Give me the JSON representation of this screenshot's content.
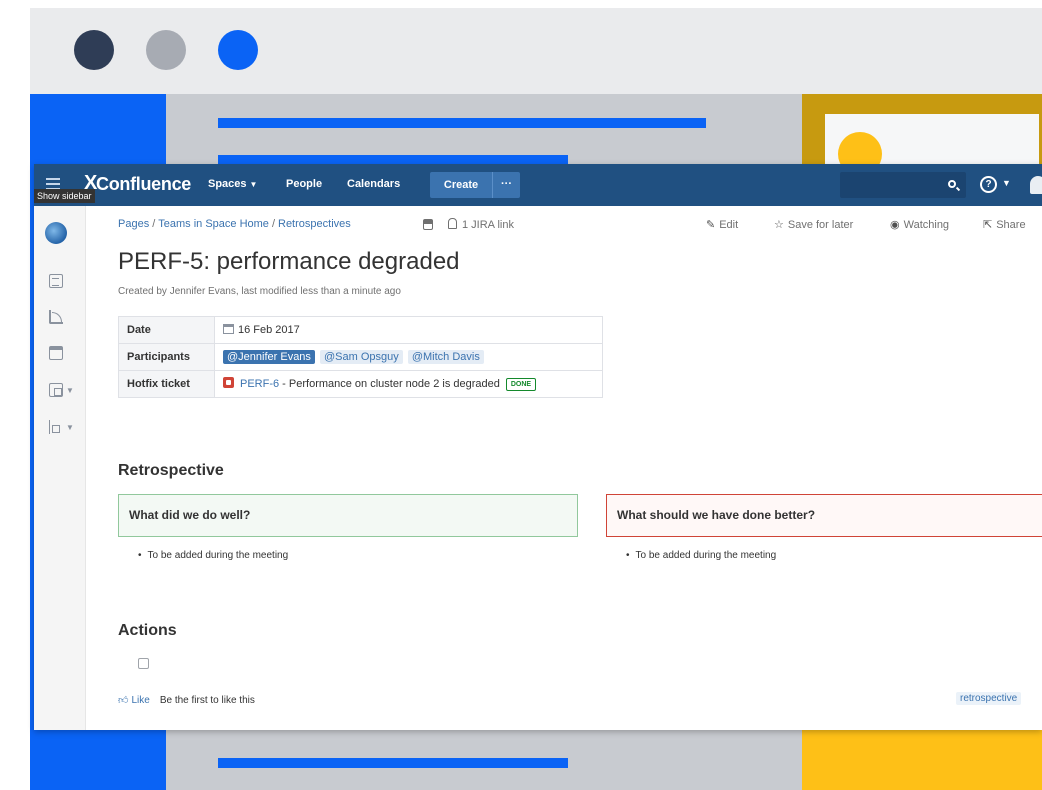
{
  "app": {
    "logo_text": "Confluence",
    "logo_mark": "X",
    "show_sidebar_tooltip": "Show sidebar"
  },
  "topnav": {
    "spaces": "Spaces",
    "people": "People",
    "calendars": "Calendars",
    "create": "Create",
    "create_more": "···",
    "help_glyph": "?"
  },
  "breadcrumb": {
    "items": [
      "Pages",
      "Teams in Space Home",
      "Retrospectives"
    ],
    "separator": "/",
    "jira_link": "1 JIRA link"
  },
  "page_actions": {
    "edit": "Edit",
    "save_for_later": "Save for later",
    "watching": "Watching",
    "share": "Share"
  },
  "page": {
    "title": "PERF-5: performance degraded",
    "byline": "Created by Jennifer Evans, last modified less than a minute ago"
  },
  "properties": {
    "date_label": "Date",
    "date_value": "16 Feb 2017",
    "participants_label": "Participants",
    "participants": [
      "@Jennifer Evans",
      "@Sam Opsguy",
      "@Mitch Davis"
    ],
    "hotfix_label": "Hotfix ticket",
    "hotfix_key": "PERF-6",
    "hotfix_summary": " - Performance on cluster node 2 is degraded",
    "hotfix_status": "DONE"
  },
  "retrospective": {
    "heading": "Retrospective",
    "good_title": "What did we do well?",
    "bad_title": "What should we have done better?",
    "good_item": "To be added during the meeting",
    "bad_item": "To be added during the meeting"
  },
  "actions": {
    "heading": "Actions"
  },
  "footer": {
    "like": "Like",
    "like_prompt": "Be the first to like this",
    "label": "retrospective"
  },
  "colors": {
    "header": "#205081",
    "link": "#3b73af",
    "accent_blue": "#0a63f5",
    "accent_yellow": "#fec017",
    "done_green": "#14892c",
    "panel_red": "#d04437"
  }
}
